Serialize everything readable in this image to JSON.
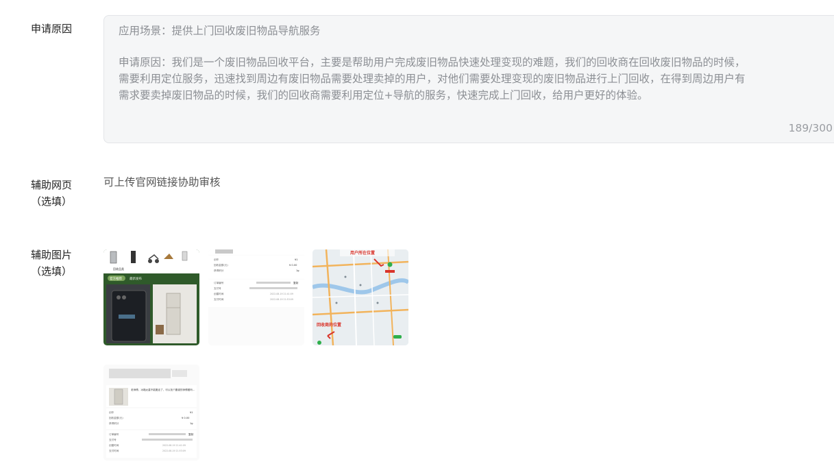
{
  "reason": {
    "label": "申请原因",
    "lines": [
      "应用场景：提供上门回收废旧物品导航服务",
      "申请原因：我们是一个废旧物品回收平台，主要是帮助用户完成废旧物品快速处理变现的难题，我们的回收商在回收废旧物品的时候，",
      "需要利用定位服务，迅速找到周边有废旧物品需要处理卖掉的用户，对他们需要处理变现的废旧物品进行上门回收，在得到周边用户有",
      "需求要卖掉废旧物品的时候，我们的回收商需要利用定位+导航的服务，快速完成上门回收，给用户更好的体验。"
    ],
    "counter": "189/300"
  },
  "website": {
    "label_line1": "辅助网页",
    "label_line2": "（选填）",
    "hint": "可上传官网链接协助审核"
  },
  "images": {
    "label_line1": "辅助图片",
    "label_line2": "（选填）",
    "thumbs": [
      {
        "name": "app-home-screenshot",
        "caption": "回收品类",
        "tag1": "官方推荐",
        "tag2": "最新发布",
        "accent": "#2f5a2a"
      },
      {
        "name": "order-detail-screenshot",
        "rows": [
          [
            "创作",
            "¥1"
          ],
          [
            "回收金额(元)",
            "¥ 0.00"
          ],
          [
            "获得积分",
            "1g"
          ],
          [
            "订单编号",
            "复制"
          ],
          [
            "支付号",
            ""
          ],
          [
            "创建时间",
            "2022-08-19 21:41:09"
          ],
          [
            "支付时间",
            "2022-08-19 21:53:09"
          ]
        ]
      },
      {
        "name": "navigation-map-screenshot",
        "map_title": "用户所在位置",
        "map_caption": "回收商的位置"
      },
      {
        "name": "order-chat-screenshot",
        "message": "老师傅，冰箱太重不能搬走了，可以找个靠谱的师傅搬吗…",
        "rows": [
          [
            "创作",
            "¥1"
          ],
          [
            "回收金额(元)",
            "¥ 0.00"
          ],
          [
            "获得积分",
            "1g"
          ],
          [
            "订单编号",
            "复制"
          ],
          [
            "支付号",
            ""
          ],
          [
            "创建时间",
            "2022-08-19 21:41:09"
          ],
          [
            "支付时间",
            "2022-08-19 21:53:09"
          ]
        ]
      }
    ]
  }
}
